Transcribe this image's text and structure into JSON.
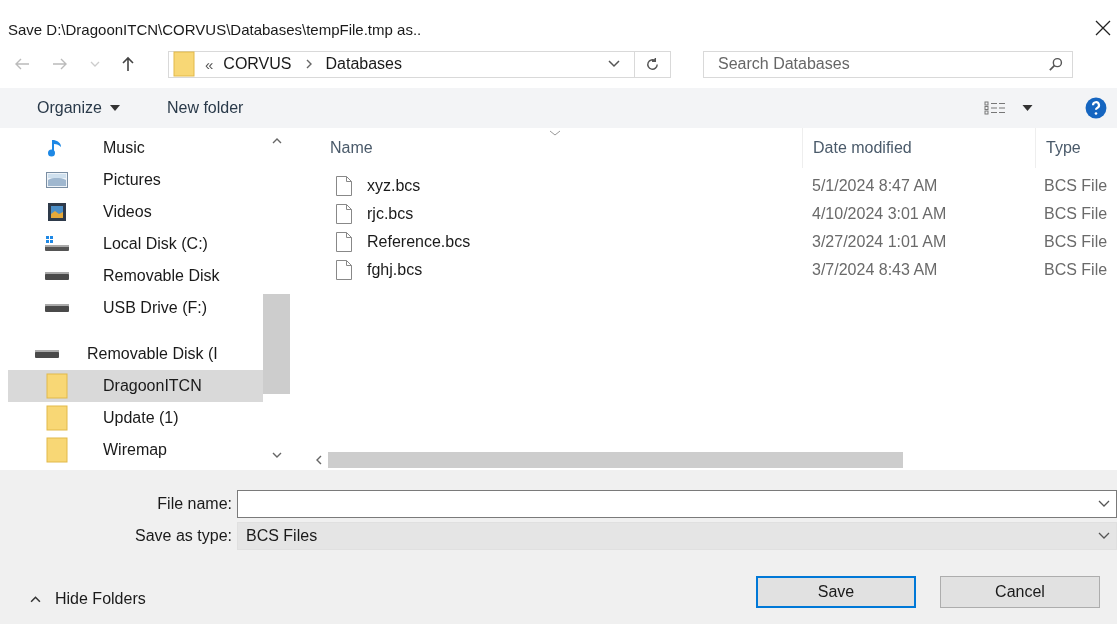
{
  "window": {
    "title": "Save D:\\DragoonITCN\\CORVUS\\Databases\\tempFile.tmp as.."
  },
  "address": {
    "overflow": "«",
    "segments": [
      "CORVUS",
      "Databases"
    ]
  },
  "search": {
    "placeholder": "Search Databases"
  },
  "toolbar": {
    "organize": "Organize",
    "new_folder": "New folder"
  },
  "sidebar": {
    "items": [
      {
        "label": "Music",
        "kind": "music",
        "selected": false
      },
      {
        "label": "Pictures",
        "kind": "pictures",
        "selected": false
      },
      {
        "label": "Videos",
        "kind": "videos",
        "selected": false
      },
      {
        "label": "Local Disk (C:)",
        "kind": "local-disk",
        "selected": false
      },
      {
        "label": "Removable Disk",
        "kind": "drive",
        "selected": false
      },
      {
        "label": "USB Drive (F:)",
        "kind": "drive",
        "selected": false
      },
      {
        "label": "Removable Disk (I",
        "kind": "drive",
        "selected": false,
        "children": [
          {
            "label": "DragoonITCN",
            "kind": "folder",
            "selected": true
          },
          {
            "label": "Update (1)",
            "kind": "folder",
            "selected": false
          },
          {
            "label": "Wiremap",
            "kind": "folder",
            "selected": false
          }
        ]
      }
    ]
  },
  "file_list": {
    "columns": [
      "Name",
      "Date modified",
      "Type"
    ],
    "rows": [
      {
        "name": "xyz.bcs",
        "date": "5/1/2024 8:47 AM",
        "type": "BCS File"
      },
      {
        "name": "rjc.bcs",
        "date": "4/10/2024 3:01 AM",
        "type": "BCS File"
      },
      {
        "name": "Reference.bcs",
        "date": "3/27/2024 1:01 AM",
        "type": "BCS File"
      },
      {
        "name": "fghj.bcs",
        "date": "3/7/2024 8:43 AM",
        "type": "BCS File"
      }
    ]
  },
  "file_name": {
    "label": "File name:"
  },
  "save_as_type": {
    "label": "Save as type:",
    "value": "BCS Files"
  },
  "hide_folders": "Hide Folders",
  "buttons": [
    {
      "label": "Save",
      "default": true
    },
    {
      "label": "Cancel",
      "default": false
    }
  ]
}
